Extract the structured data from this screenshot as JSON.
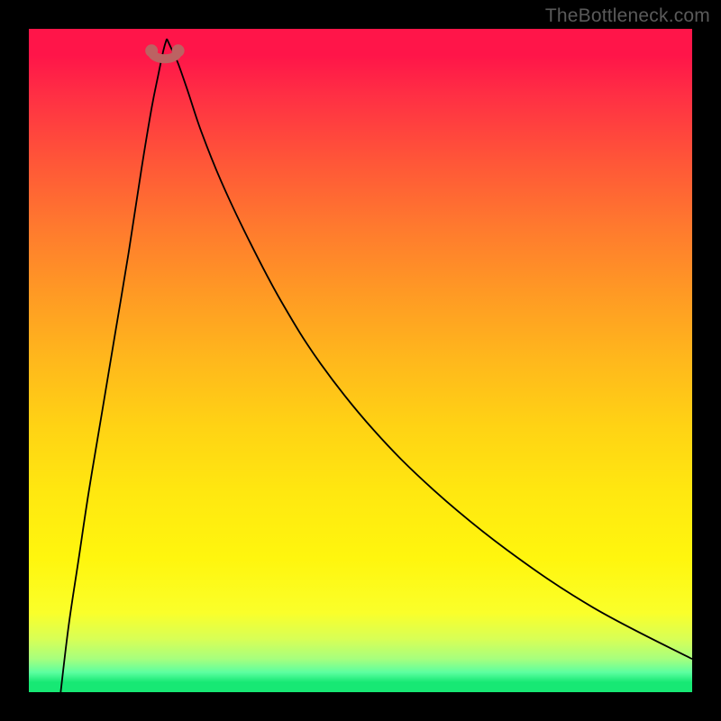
{
  "attribution": "TheBottleneck.com",
  "chart_data": {
    "type": "line",
    "title": "",
    "xlabel": "",
    "ylabel": "",
    "xlim": [
      0,
      1
    ],
    "ylim": [
      0,
      1
    ],
    "minimum_x": 0.208,
    "markers": [
      {
        "x": 0.185,
        "y": 0.967
      },
      {
        "x": 0.225,
        "y": 0.967
      }
    ],
    "series": [
      {
        "name": "left-branch",
        "x": [
          0.048,
          0.06,
          0.075,
          0.09,
          0.11,
          0.13,
          0.15,
          0.17,
          0.185,
          0.195,
          0.203,
          0.208
        ],
        "values": [
          0.0,
          0.1,
          0.2,
          0.3,
          0.42,
          0.54,
          0.66,
          0.79,
          0.88,
          0.93,
          0.968,
          0.985
        ]
      },
      {
        "name": "right-branch",
        "x": [
          0.208,
          0.215,
          0.225,
          0.24,
          0.26,
          0.29,
          0.33,
          0.38,
          0.44,
          0.52,
          0.61,
          0.72,
          0.85,
          1.0
        ],
        "values": [
          0.985,
          0.97,
          0.948,
          0.905,
          0.845,
          0.77,
          0.685,
          0.59,
          0.495,
          0.395,
          0.305,
          0.215,
          0.128,
          0.05
        ]
      }
    ],
    "gradient_stops": [
      {
        "pos": 0.0,
        "color": "#ff1549"
      },
      {
        "pos": 0.5,
        "color": "#ffb81c"
      },
      {
        "pos": 0.88,
        "color": "#faff2a"
      },
      {
        "pos": 1.0,
        "color": "#17e874"
      }
    ]
  }
}
